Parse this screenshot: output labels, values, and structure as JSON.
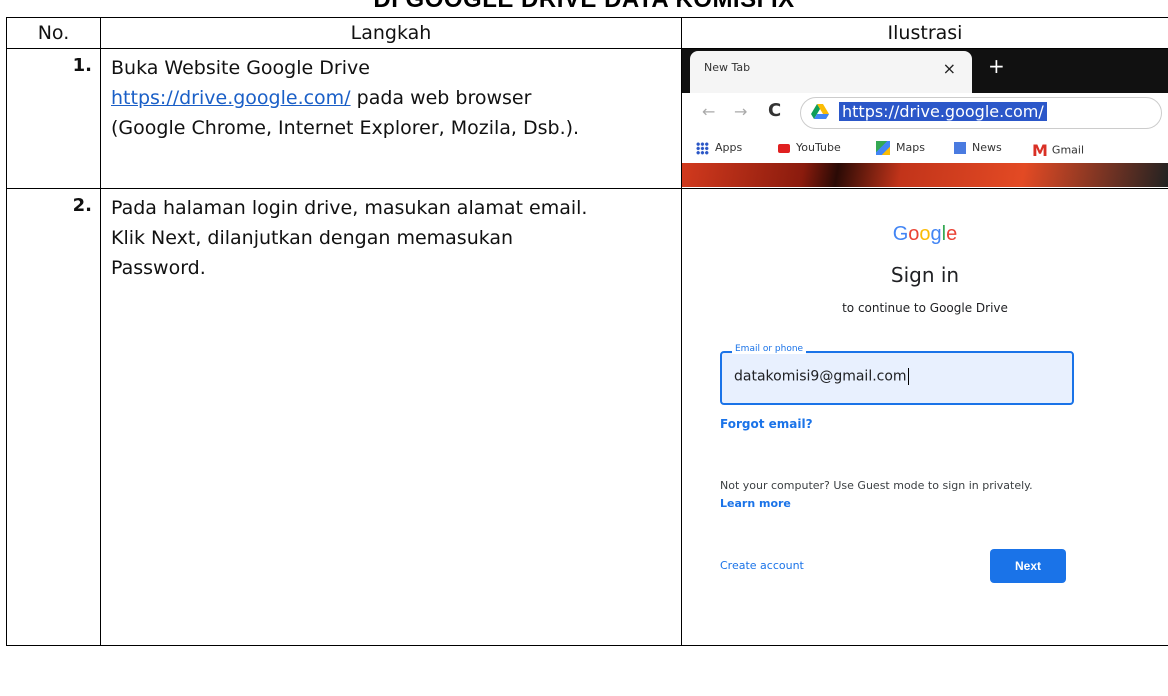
{
  "document": {
    "title": "DI GOOGLE DRIVE DATA KOMISI IX"
  },
  "table": {
    "headers": {
      "no": "No.",
      "step": "Langkah",
      "illustration": "Ilustrasi"
    },
    "rows": [
      {
        "no": "1.",
        "line1": "Buka Website Google Drive",
        "link": "https://drive.google.com/",
        "after_link": " pada web browser",
        "line3": "(Google Chrome, Internet Explorer, Mozila, Dsb.)."
      },
      {
        "no": "2.",
        "line1": "Pada halaman login drive, masukan alamat email.",
        "line2": "Klik Next, dilanjutkan dengan memasukan",
        "line3": "Password."
      }
    ]
  },
  "browser": {
    "tab_title": "New Tab",
    "close_glyph": "×",
    "new_tab_glyph": "+",
    "back_glyph": "←",
    "forward_glyph": "→",
    "reload_glyph": "C",
    "url": "https://drive.google.com/",
    "bookmarks": [
      "Apps",
      "YouTube",
      "Maps",
      "News",
      "Gmail"
    ],
    "gmail_glyph": "M"
  },
  "signin": {
    "logo_letters": [
      "G",
      "o",
      "o",
      "g",
      "l",
      "e"
    ],
    "logo_colors": [
      "#4285f4",
      "#ea4335",
      "#fbbc05",
      "#4285f4",
      "#34a853",
      "#ea4335"
    ],
    "title": "Sign in",
    "subtitle": "to continue to Google Drive",
    "email_label": "Email or phone",
    "email_value": "datakomisi9@gmail.com",
    "forgot": "Forgot email?",
    "not_your_computer": "Not your computer? Use Guest mode to sign in privately.",
    "learn_more": "Learn more",
    "create_account": "Create account",
    "next": "Next"
  }
}
